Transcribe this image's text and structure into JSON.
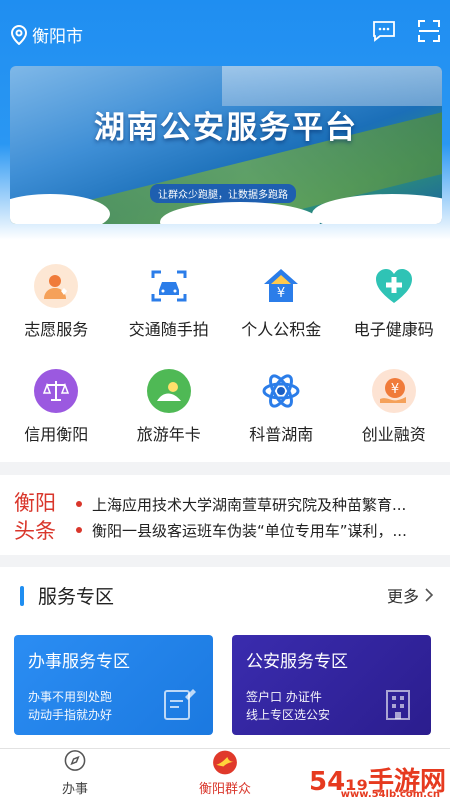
{
  "header": {
    "city": "衡阳市"
  },
  "banner": {
    "title": "湖南公安服务平台",
    "subtitle": "让群众少跑腿，让数据多跑路"
  },
  "grid": [
    {
      "label": "志愿服务",
      "icon": "volunteer-icon",
      "color": "#f5a15a"
    },
    {
      "label": "交通随手拍",
      "icon": "traffic-camera-icon",
      "color": "#2b7de9"
    },
    {
      "label": "个人公积金",
      "icon": "housing-fund-icon",
      "color": "#2b7de9"
    },
    {
      "label": "电子健康码",
      "icon": "health-code-icon",
      "color": "#2fc3b5"
    },
    {
      "label": "信用衡阳",
      "icon": "credit-scale-icon",
      "color": "#9b59e0"
    },
    {
      "label": "旅游年卡",
      "icon": "travel-card-icon",
      "color": "#4fb955"
    },
    {
      "label": "科普湖南",
      "icon": "atom-icon",
      "color": "#2b7de9"
    },
    {
      "label": "创业融资",
      "icon": "finance-icon",
      "color": "#f07b3a"
    }
  ],
  "news": {
    "tag_line1": "衡阳",
    "tag_line2": "头条",
    "items": [
      "上海应用技术大学湖南萱草研究院及种苗繁育...",
      "衡阳一县级客运班车伪装“单位专用车”谋利，..."
    ]
  },
  "services": {
    "title": "服务专区",
    "more": "更多",
    "cards": [
      {
        "title": "办事服务专区",
        "line1": "办事不用到处跑",
        "line2": "动动手指就办好"
      },
      {
        "title": "公安服务专区",
        "line1": "签户口 办证件",
        "line2": "线上专区选公安"
      }
    ]
  },
  "tabbar": {
    "tab1": "办事",
    "tab2": "衡阳群众"
  },
  "watermark": {
    "text": "54₁₉手游网",
    "domain": "www.54lb.com.cn"
  },
  "colors": {
    "primary": "#1f8ef1",
    "accent_red": "#d9362b"
  }
}
